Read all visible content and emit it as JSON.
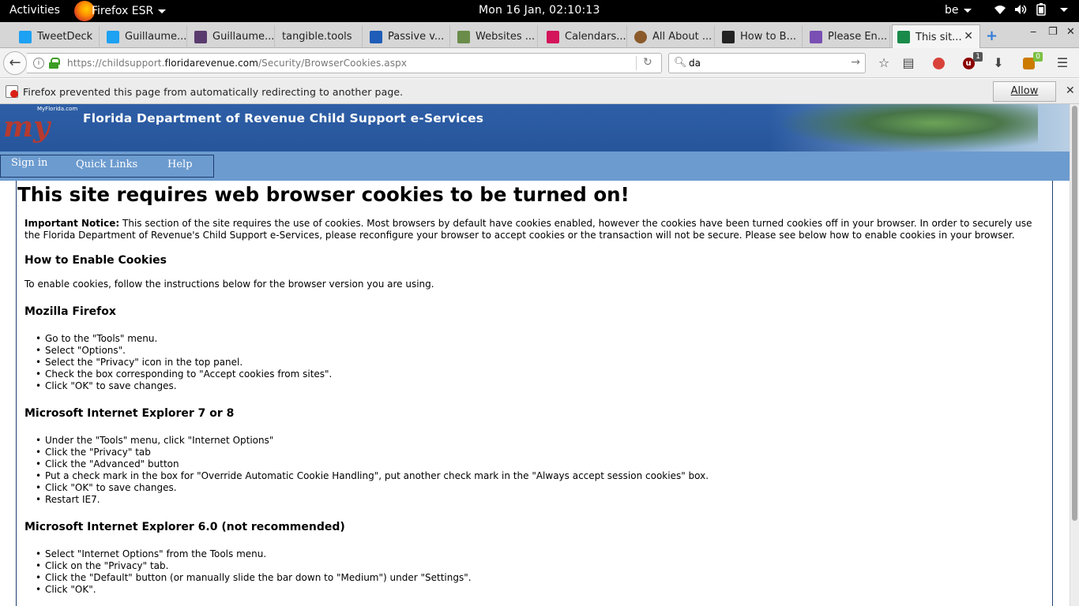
{
  "topbar": {
    "activities": "Activities",
    "app_name": "Firefox ESR",
    "clock": "Mon 16 Jan, 02:10:13",
    "keyboard": "be"
  },
  "tabs": [
    {
      "label": "TweetDeck",
      "favicon": "twitter-icon",
      "color": "#1da1f2"
    },
    {
      "label": "Guillaume...",
      "favicon": "twitter-icon",
      "color": "#1da1f2"
    },
    {
      "label": "Guillaume...",
      "favicon": "image-icon",
      "color": "#5a3b6e"
    },
    {
      "label": "tangible.tools",
      "favicon": "",
      "color": ""
    },
    {
      "label": "Passive v...",
      "favicon": "ef-icon",
      "color": "#1f5db8"
    },
    {
      "label": "Websites ...",
      "favicon": "zine-icon",
      "color": "#6a8c4a"
    },
    {
      "label": "Calendars...",
      "favicon": "calendar-icon",
      "color": "#d4145a"
    },
    {
      "label": "All About ...",
      "favicon": "cookie-icon",
      "color": "#8b5a2b"
    },
    {
      "label": "How to B...",
      "favicon": "htg-icon",
      "color": "#222222"
    },
    {
      "label": "Please En...",
      "favicon": "wizard-icon",
      "color": "#7a4fb3"
    },
    {
      "label": "This sit...",
      "favicon": "florida-icon",
      "color": "#1a8a4a",
      "active": true
    }
  ],
  "navbar": {
    "url_prefix": "https://childsupport.",
    "url_domain": "floridarevenue.com",
    "url_path": "/Security/BrowserCookies.aspx",
    "search_value": "da",
    "ublock_badge": "1",
    "addon_badge": "0"
  },
  "notification": {
    "message": "Firefox prevented this page from automatically redirecting to another page.",
    "allow_label": "Allow"
  },
  "site": {
    "logo_small": "MyFlorida.com",
    "logo_text": "my",
    "title": "Florida Department of Revenue Child Support e-Services",
    "menu": [
      "Sign in",
      "Quick Links",
      "Help"
    ]
  },
  "content": {
    "heading": "This site requires web browser cookies to be turned on!",
    "notice_label": "Important Notice:",
    "notice_text": " This section of the site requires the use of cookies. Most browsers by default have cookies enabled, however the cookies have been turned cookies off in your browser. In order to securely use the Florida Department of Revenue's Child Support e-Services, please reconfigure your browser to accept cookies or the transaction will not be secure. Please see below how to enable cookies in your browser.",
    "how_heading": "How to Enable Cookies",
    "how_text": "To enable cookies, follow the instructions below for the browser version you are using.",
    "sections": [
      {
        "title": "Mozilla Firefox",
        "steps": [
          "Go to the \"Tools\" menu.",
          "Select \"Options\".",
          "Select the \"Privacy\" icon in the top panel.",
          "Check the box corresponding to \"Accept cookies from sites\".",
          "Click \"OK\" to save changes."
        ]
      },
      {
        "title": "Microsoft Internet Explorer 7 or 8",
        "steps": [
          "Under the \"Tools\" menu, click \"Internet Options\"",
          "Click the \"Privacy\" tab",
          "Click the \"Advanced\" button",
          "Put a check mark in the box for \"Override Automatic Cookie Handling\", put another check mark in the \"Always accept session cookies\" box.",
          "Click \"OK\" to save changes.",
          "Restart IE7."
        ]
      },
      {
        "title": "Microsoft Internet Explorer 6.0 (not recommended)",
        "steps": [
          "Select \"Internet Options\" from the Tools menu.",
          "Click on the \"Privacy\" tab.",
          "Click the \"Default\" button (or manually slide the bar down to \"Medium\") under \"Settings\".",
          "Click \"OK\"."
        ]
      }
    ]
  }
}
